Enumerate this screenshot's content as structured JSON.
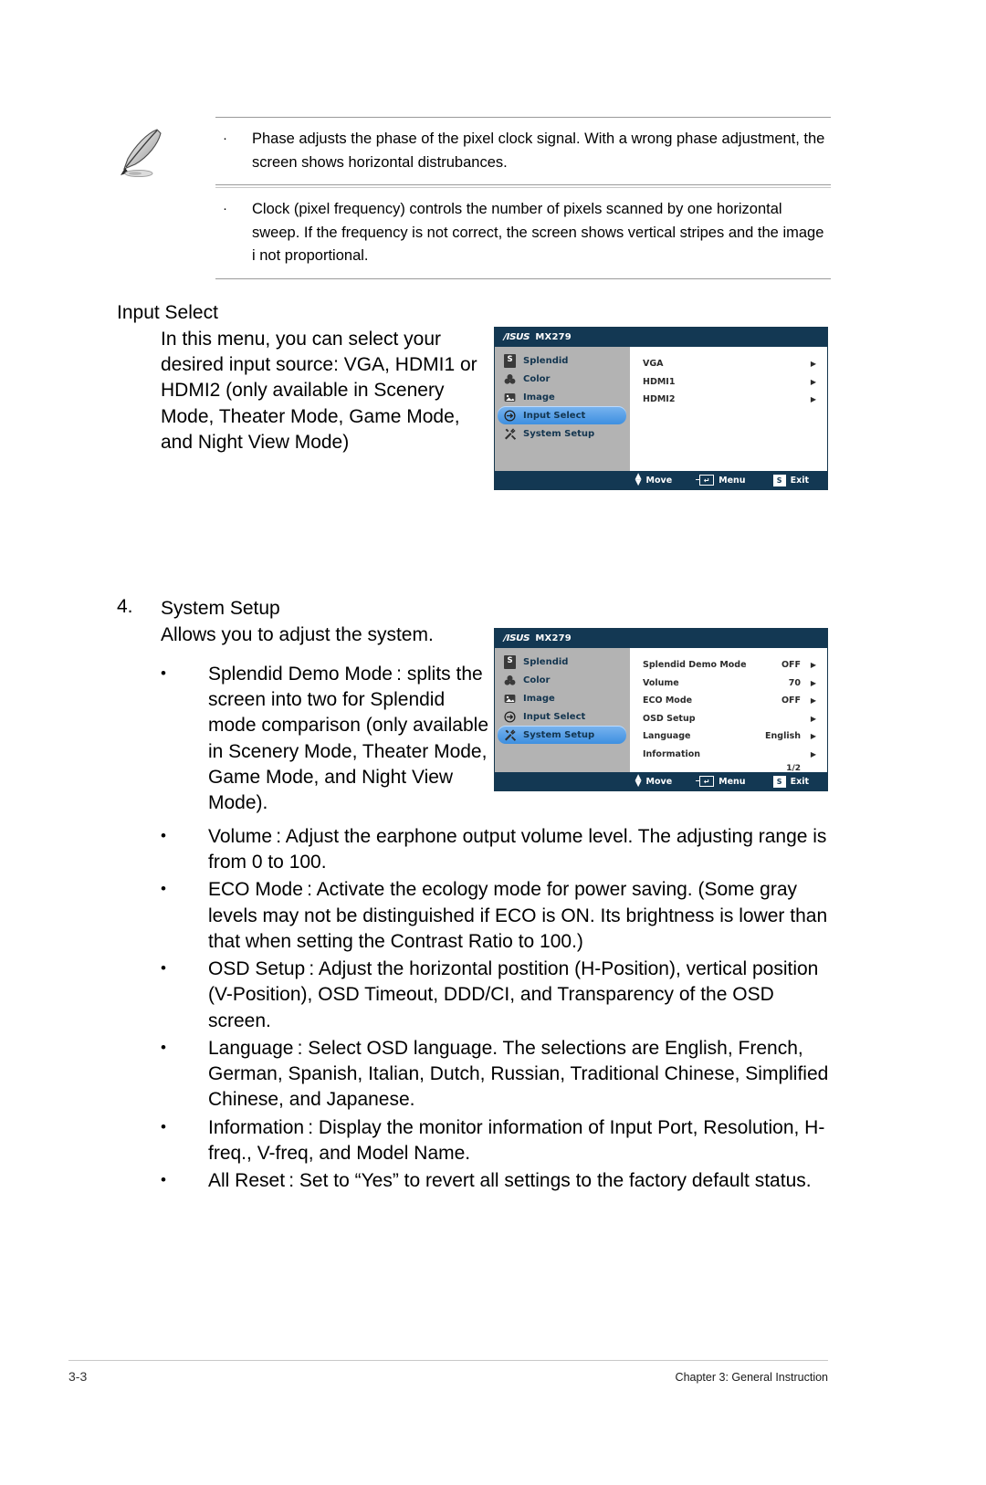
{
  "note": {
    "icon": "pencil-note-icon",
    "items": [
      {
        "bullet": "·",
        "text": "Phase adjusts the phase of the pixel clock signal. With a wrong phase adjustment, the screen shows horizontal distrubances."
      },
      {
        "bullet": "·",
        "text": "Clock (pixel frequency) controls the number of pixels scanned by one horizontal sweep. If the frequency is not correct, the screen shows vertical stripes and the image i not proportional."
      }
    ]
  },
  "input_select": {
    "heading": "Input Select",
    "paragraph": "In this menu, you can select your desired input source: VGA, HDMI1 or HDMI2 (only available in Scenery Mode, Theater Mode, Game Mode, and Night View Mode)"
  },
  "system_setup": {
    "number": "4.",
    "heading": "System Setup",
    "intro": "Allows you to adjust the system.",
    "bullets": [
      {
        "marker": "•",
        "text": "Splendid Demo Mode : splits the screen into two for Splendid mode comparison (only available in Scenery Mode, Theater Mode, Game Mode, and Night View Mode)."
      },
      {
        "marker": "•",
        "text": "Volume : Adjust the earphone output volume level. The adjusting range is from 0 to 100."
      },
      {
        "marker": "•",
        "text": "ECO Mode : Activate the ecology mode for power saving. (Some gray levels may not be distinguished if ECO is ON. Its brightness is lower than that when setting the Contrast Ratio to 100.)"
      },
      {
        "marker": "•",
        "text": "OSD Setup : Adjust the horizontal postition (H-Position), vertical position (V-Position), OSD Timeout, DDD/CI, and Transparency of the OSD screen."
      },
      {
        "marker": "•",
        "text": "Language : Select OSD language. The selections are English, French, German, Spanish, Italian, Dutch, Russian, Traditional Chinese, Simplified Chinese, and Japanese."
      },
      {
        "marker": "•",
        "text": "Information : Display the monitor information of Input Port, Resolution, H-freq., V-freq, and Model Name."
      },
      {
        "marker": "•",
        "text": "All Reset : Set to “Yes” to revert all settings to the factory default status."
      }
    ]
  },
  "osd_input_select": {
    "brand": "/ISUS",
    "model": "MX279",
    "nav": [
      {
        "icon": "splendid-icon",
        "glyph": "S",
        "label": "Splendid",
        "active": false
      },
      {
        "icon": "color-icon",
        "glyph": "♣",
        "label": "Color",
        "active": false
      },
      {
        "icon": "image-icon",
        "glyph": "▣",
        "label": "Image",
        "active": false
      },
      {
        "icon": "input-select-icon",
        "glyph": "⊕",
        "label": "Input Select",
        "active": true
      },
      {
        "icon": "system-setup-icon",
        "glyph": "⚒",
        "label": "System Setup",
        "active": false
      }
    ],
    "options": [
      {
        "name": "VGA",
        "value": "",
        "arrow": "▶"
      },
      {
        "name": "HDMI1",
        "value": "",
        "arrow": "▶"
      },
      {
        "name": "HDMI2",
        "value": "",
        "arrow": "▶"
      }
    ],
    "page_count": "",
    "status": [
      {
        "icon": "move-key-icon",
        "label": "Move"
      },
      {
        "icon": "menu-key-icon",
        "label": "Menu"
      },
      {
        "icon": "exit-key-icon",
        "glyph": "S",
        "label": "Exit"
      }
    ]
  },
  "osd_system_setup": {
    "brand": "/ISUS",
    "model": "MX279",
    "nav": [
      {
        "icon": "splendid-icon",
        "glyph": "S",
        "label": "Splendid",
        "active": false
      },
      {
        "icon": "color-icon",
        "glyph": "♣",
        "label": "Color",
        "active": false
      },
      {
        "icon": "image-icon",
        "glyph": "▣",
        "label": "Image",
        "active": false
      },
      {
        "icon": "input-select-icon",
        "glyph": "⊕",
        "label": "Input Select",
        "active": false
      },
      {
        "icon": "system-setup-icon",
        "glyph": "⚒",
        "label": "System Setup",
        "active": true
      }
    ],
    "options": [
      {
        "name": "Splendid Demo Mode",
        "value": "OFF",
        "arrow": "▶"
      },
      {
        "name": "Volume",
        "value": "70",
        "arrow": "▶"
      },
      {
        "name": "ECO Mode",
        "value": "OFF",
        "arrow": "▶"
      },
      {
        "name": "OSD Setup",
        "value": "",
        "arrow": "▶"
      },
      {
        "name": "Language",
        "value": "English",
        "arrow": "▶"
      },
      {
        "name": "Information",
        "value": "",
        "arrow": "▶"
      }
    ],
    "page_count": "1/2",
    "status": [
      {
        "icon": "move-key-icon",
        "label": "Move"
      },
      {
        "icon": "menu-key-icon",
        "label": "Menu"
      },
      {
        "icon": "exit-key-icon",
        "glyph": "S",
        "label": "Exit"
      }
    ]
  },
  "footer": {
    "page_number": "3-3",
    "chapter": "Chapter 3: General Instruction"
  },
  "colors": {
    "osd_dark_blue": "#133853",
    "osd_nav_gray": "#b3b3b3",
    "osd_highlight_blue": "#3d8fe0",
    "rule_gray": "#9a9a9a"
  }
}
